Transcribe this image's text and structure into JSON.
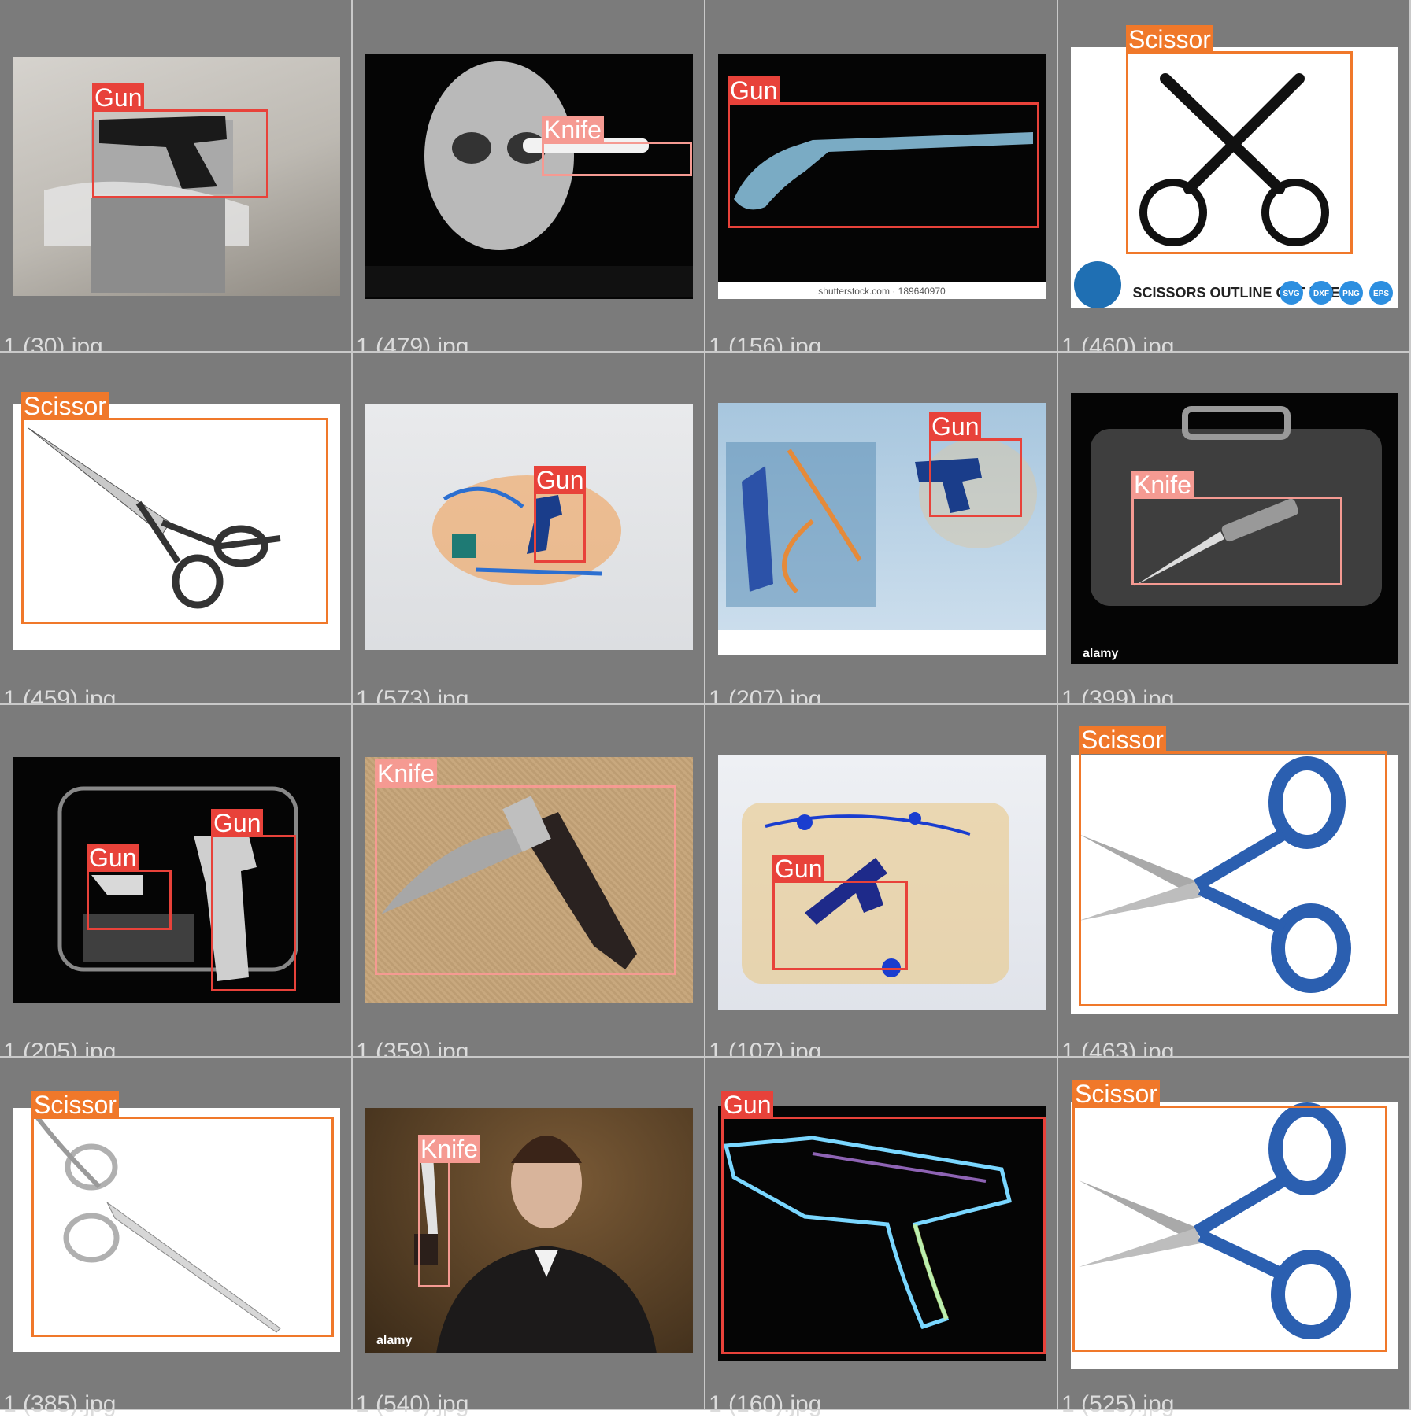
{
  "label_colors": {
    "Gun": "#e8423a",
    "Knife": "#f59a92",
    "Scissor": "#f0782a"
  },
  "tiles": [
    {
      "file": "1 (30).jpg",
      "scene": "photo-gray",
      "object": "gun",
      "dets": [
        {
          "label": "Gun"
        }
      ]
    },
    {
      "file": "1 (479).jpg",
      "scene": "xray-black",
      "object": "skull",
      "dets": [
        {
          "label": "Knife"
        }
      ]
    },
    {
      "file": "1 (156).jpg",
      "scene": "xray-black",
      "object": "pistol-long",
      "stock_text": "shutterstock.com · 189640970",
      "dets": [
        {
          "label": "Gun"
        }
      ]
    },
    {
      "file": "1 (460).jpg",
      "scene": "white",
      "object": "scissors-outline",
      "banner_text": "SCISSORS OUTLINE CUT FILE",
      "badges": [
        "SVG",
        "DXF",
        "PNG",
        "EPS"
      ],
      "dets": [
        {
          "label": "Scissor"
        }
      ]
    },
    {
      "file": "1 (459).jpg",
      "scene": "white",
      "object": "scissors-silver",
      "dets": [
        {
          "label": "Scissor"
        }
      ]
    },
    {
      "file": "1 (573).jpg",
      "scene": "xray-light",
      "object": "bag-orange",
      "dets": [
        {
          "label": "Gun"
        }
      ]
    },
    {
      "file": "1 (207).jpg",
      "scene": "xray-blue",
      "object": "bag-blue",
      "dets": [
        {
          "label": "Gun"
        }
      ]
    },
    {
      "file": "1 (399).jpg",
      "scene": "xray-black",
      "object": "briefcase",
      "stock_text": "alamy",
      "dets": [
        {
          "label": "Knife"
        }
      ]
    },
    {
      "file": "1 (205).jpg",
      "scene": "xray-black",
      "object": "bag-guns",
      "dets": [
        {
          "label": "Gun"
        },
        {
          "label": "Gun"
        }
      ]
    },
    {
      "file": "1 (359).jpg",
      "scene": "photo-tan",
      "object": "folding-knife",
      "dets": [
        {
          "label": "Knife"
        }
      ]
    },
    {
      "file": "1 (107).jpg",
      "scene": "xray-yellow",
      "object": "bag-yellow",
      "dets": [
        {
          "label": "Gun"
        }
      ]
    },
    {
      "file": "1 (463).jpg",
      "scene": "white",
      "object": "scissors-blue",
      "dets": [
        {
          "label": "Scissor"
        }
      ]
    },
    {
      "file": "1 (385).jpg",
      "scene": "white",
      "object": "scissors-ornate",
      "dets": [
        {
          "label": "Scissor"
        }
      ]
    },
    {
      "file": "1 (540).jpg",
      "scene": "photo-brown",
      "object": "person-knife",
      "stock_text": "alamy",
      "dets": [
        {
          "label": "Knife"
        }
      ]
    },
    {
      "file": "1 (160).jpg",
      "scene": "xray-black",
      "object": "rifle",
      "dets": [
        {
          "label": "Gun"
        }
      ]
    },
    {
      "file": "1 (525).jpg",
      "scene": "white",
      "object": "scissors-blue",
      "dets": [
        {
          "label": "Scissor"
        }
      ]
    }
  ]
}
